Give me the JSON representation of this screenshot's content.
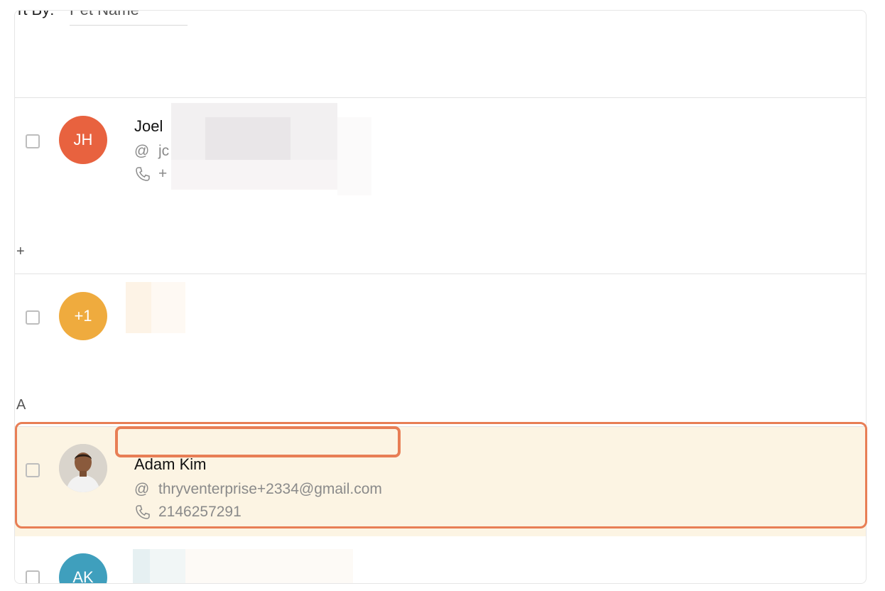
{
  "sort": {
    "label": "rt By:",
    "value": "Pet Name"
  },
  "sections": [
    {
      "letter": "+"
    },
    {
      "letter": "A"
    }
  ],
  "contacts": [
    {
      "initials": "JH",
      "name": "Joel",
      "email": "jc",
      "phone": "+",
      "color": "#e8623f"
    },
    {
      "initials": "+1",
      "color": "#efab3e"
    },
    {
      "name": "Adam Kim",
      "email": "thryventerprise+2334@gmail.com",
      "phone": "2146257291",
      "selected": true
    },
    {
      "initials": "AK",
      "color": "#3f9fbd"
    }
  ],
  "colors": {
    "highlight_bg": "#fcf4e3",
    "accent_outline": "#e87e55"
  },
  "icons": {
    "email": "at-icon",
    "phone": "phone-icon"
  }
}
